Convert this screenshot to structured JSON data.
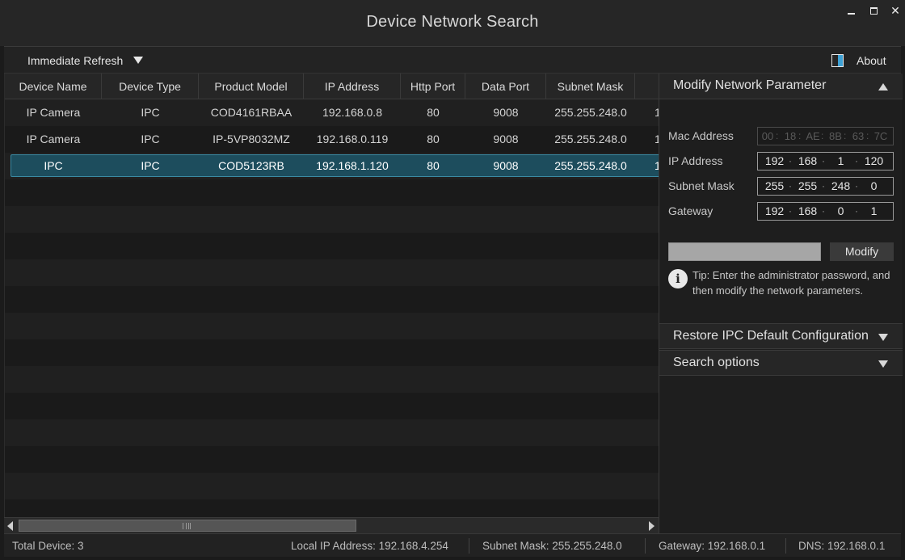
{
  "window": {
    "title": "Device Network Search",
    "min_symbol": "–",
    "close_symbol": "✕"
  },
  "toolbar": {
    "refresh_label": "Immediate Refresh",
    "about_label": "About",
    "about_icon": "about-icon",
    "accent_color": "#3ea2d6"
  },
  "table": {
    "columns": [
      "Device Name",
      "Device Type",
      "Product Model",
      "IP Address",
      "Http Port",
      "Data Port",
      "Subnet Mask"
    ],
    "rows": [
      {
        "name": "IP Camera",
        "type": "IPC",
        "model": "COD4161RBAA",
        "ip": "192.168.0.8",
        "http": "80",
        "data": "9008",
        "mask": "255.255.248.0",
        "extra": "1"
      },
      {
        "name": "IP Camera",
        "type": "IPC",
        "model": "IP-5VP8032MZ",
        "ip": "192.168.0.119",
        "http": "80",
        "data": "9008",
        "mask": "255.255.248.0",
        "extra": "1"
      },
      {
        "name": "IPC",
        "type": "IPC",
        "model": "COD5123RB",
        "ip": "192.168.1.120",
        "http": "80",
        "data": "9008",
        "mask": "255.255.248.0",
        "extra": "1"
      }
    ],
    "selected_row": 2,
    "selected_color": "#1d4d5d"
  },
  "panel": {
    "modify": {
      "title": "Modify Network Parameter",
      "mac_label": "Mac Address",
      "mac": [
        "00",
        "18",
        "AE",
        "8B",
        "63",
        "7C"
      ],
      "ip_label": "IP Address",
      "ip": [
        "192",
        "168",
        "1",
        "120"
      ],
      "mask_label": "Subnet Mask",
      "mask": [
        "255",
        "255",
        "248",
        "0"
      ],
      "gateway_label": "Gateway",
      "gateway": [
        "192",
        "168",
        "0",
        "1"
      ],
      "modify_button": "Modify",
      "tip": "Tip: Enter the administrator password, and then modify the network parameters.",
      "tip_icon_glyph": "i"
    },
    "restore": {
      "title": "Restore IPC Default Configuration"
    },
    "search": {
      "title": "Search options"
    }
  },
  "status": {
    "total": "Total Device: 3",
    "local_ip": "Local IP Address: 192.168.4.254",
    "subnet": "Subnet Mask: 255.255.248.0",
    "gateway": "Gateway: 192.168.0.1",
    "dns": "DNS: 192.168.0.1"
  }
}
